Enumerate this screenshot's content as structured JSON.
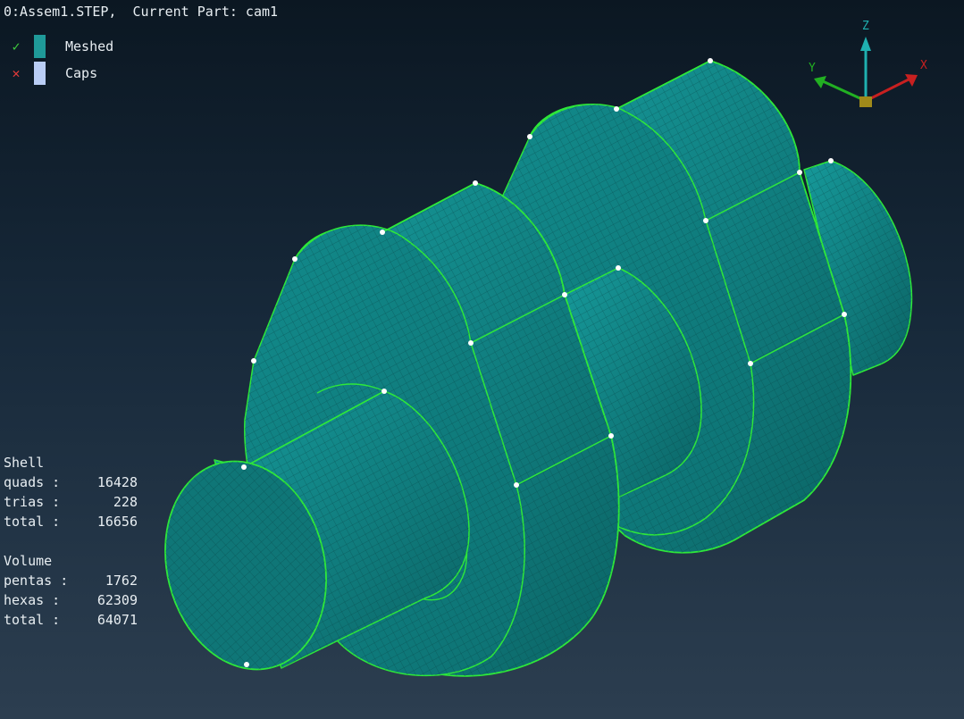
{
  "header": {
    "title": "0:Assem1.STEP,  Current Part: cam1"
  },
  "legend": [
    {
      "mark": "✓",
      "mark_color": "#3ec93e",
      "swatch": "#1f9a99",
      "label": "Meshed"
    },
    {
      "mark": "✕",
      "mark_color": "#e23a3a",
      "swatch": "#b9cdf5",
      "label": "Caps"
    }
  ],
  "stats": {
    "shell": {
      "heading": "Shell",
      "rows": [
        {
          "key": "quads",
          "value": "16428"
        },
        {
          "key": "trias",
          "value": "228"
        },
        {
          "key": "total",
          "value": "16656"
        }
      ]
    },
    "volume": {
      "heading": "Volume",
      "rows": [
        {
          "key": "pentas",
          "value": "1762"
        },
        {
          "key": "hexas",
          "value": "62309"
        },
        {
          "key": "total",
          "value": "64071"
        }
      ]
    }
  },
  "triad": {
    "x_label": "X",
    "y_label": "Y",
    "z_label": "Z",
    "x_color": "#c82020",
    "y_color": "#22b022",
    "z_color": "#1fb0b0"
  },
  "colors": {
    "mesh_fill": "#0f7f80",
    "mesh_fill_dark": "#0a5b5c",
    "mesh_fill_light": "#15908f",
    "edge": "#2ee83a",
    "vertex": "#ffffff"
  }
}
